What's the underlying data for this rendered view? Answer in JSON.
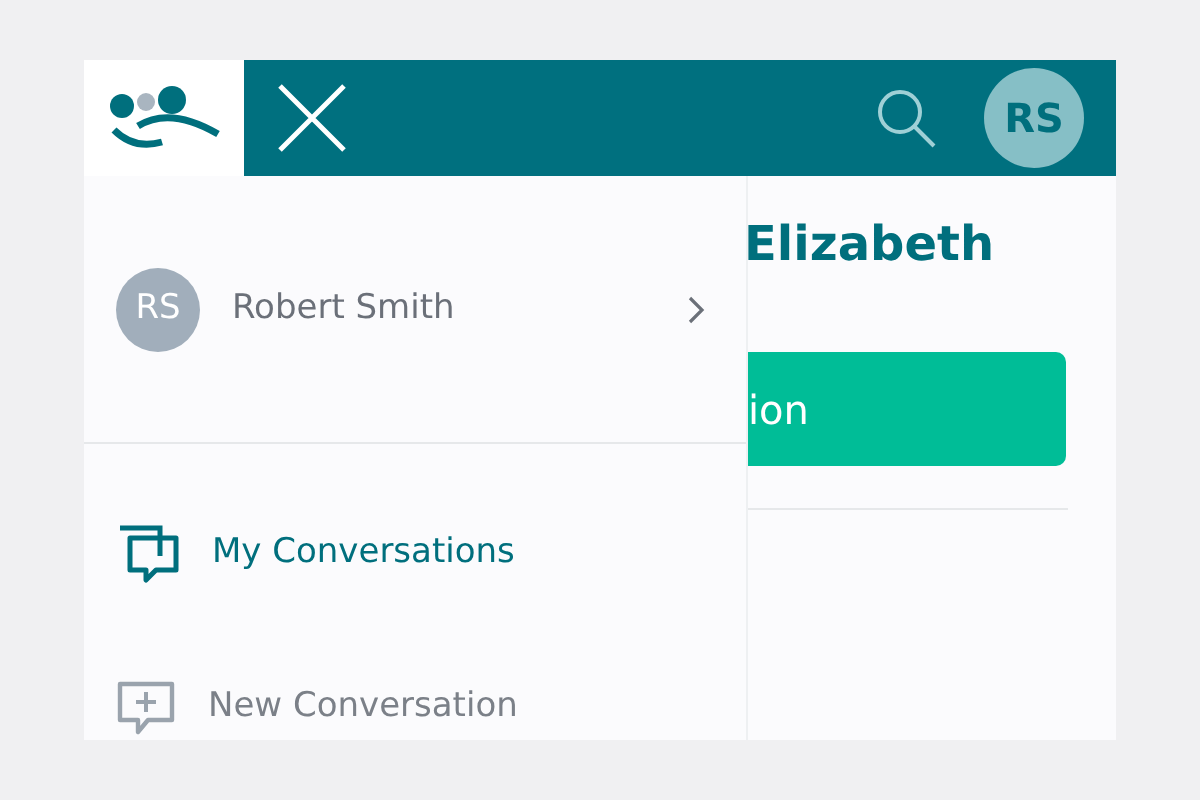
{
  "header": {
    "avatar_initials": "RS"
  },
  "main": {
    "greeting": "Elizabeth",
    "action_button": "ion"
  },
  "drawer": {
    "user": {
      "initials": "RS",
      "name": "Robert Smith"
    },
    "items": [
      {
        "label": "My Conversations",
        "kind": "conversations",
        "selected": true
      },
      {
        "label": "New Conversation",
        "kind": "new",
        "selected": false
      }
    ]
  }
}
